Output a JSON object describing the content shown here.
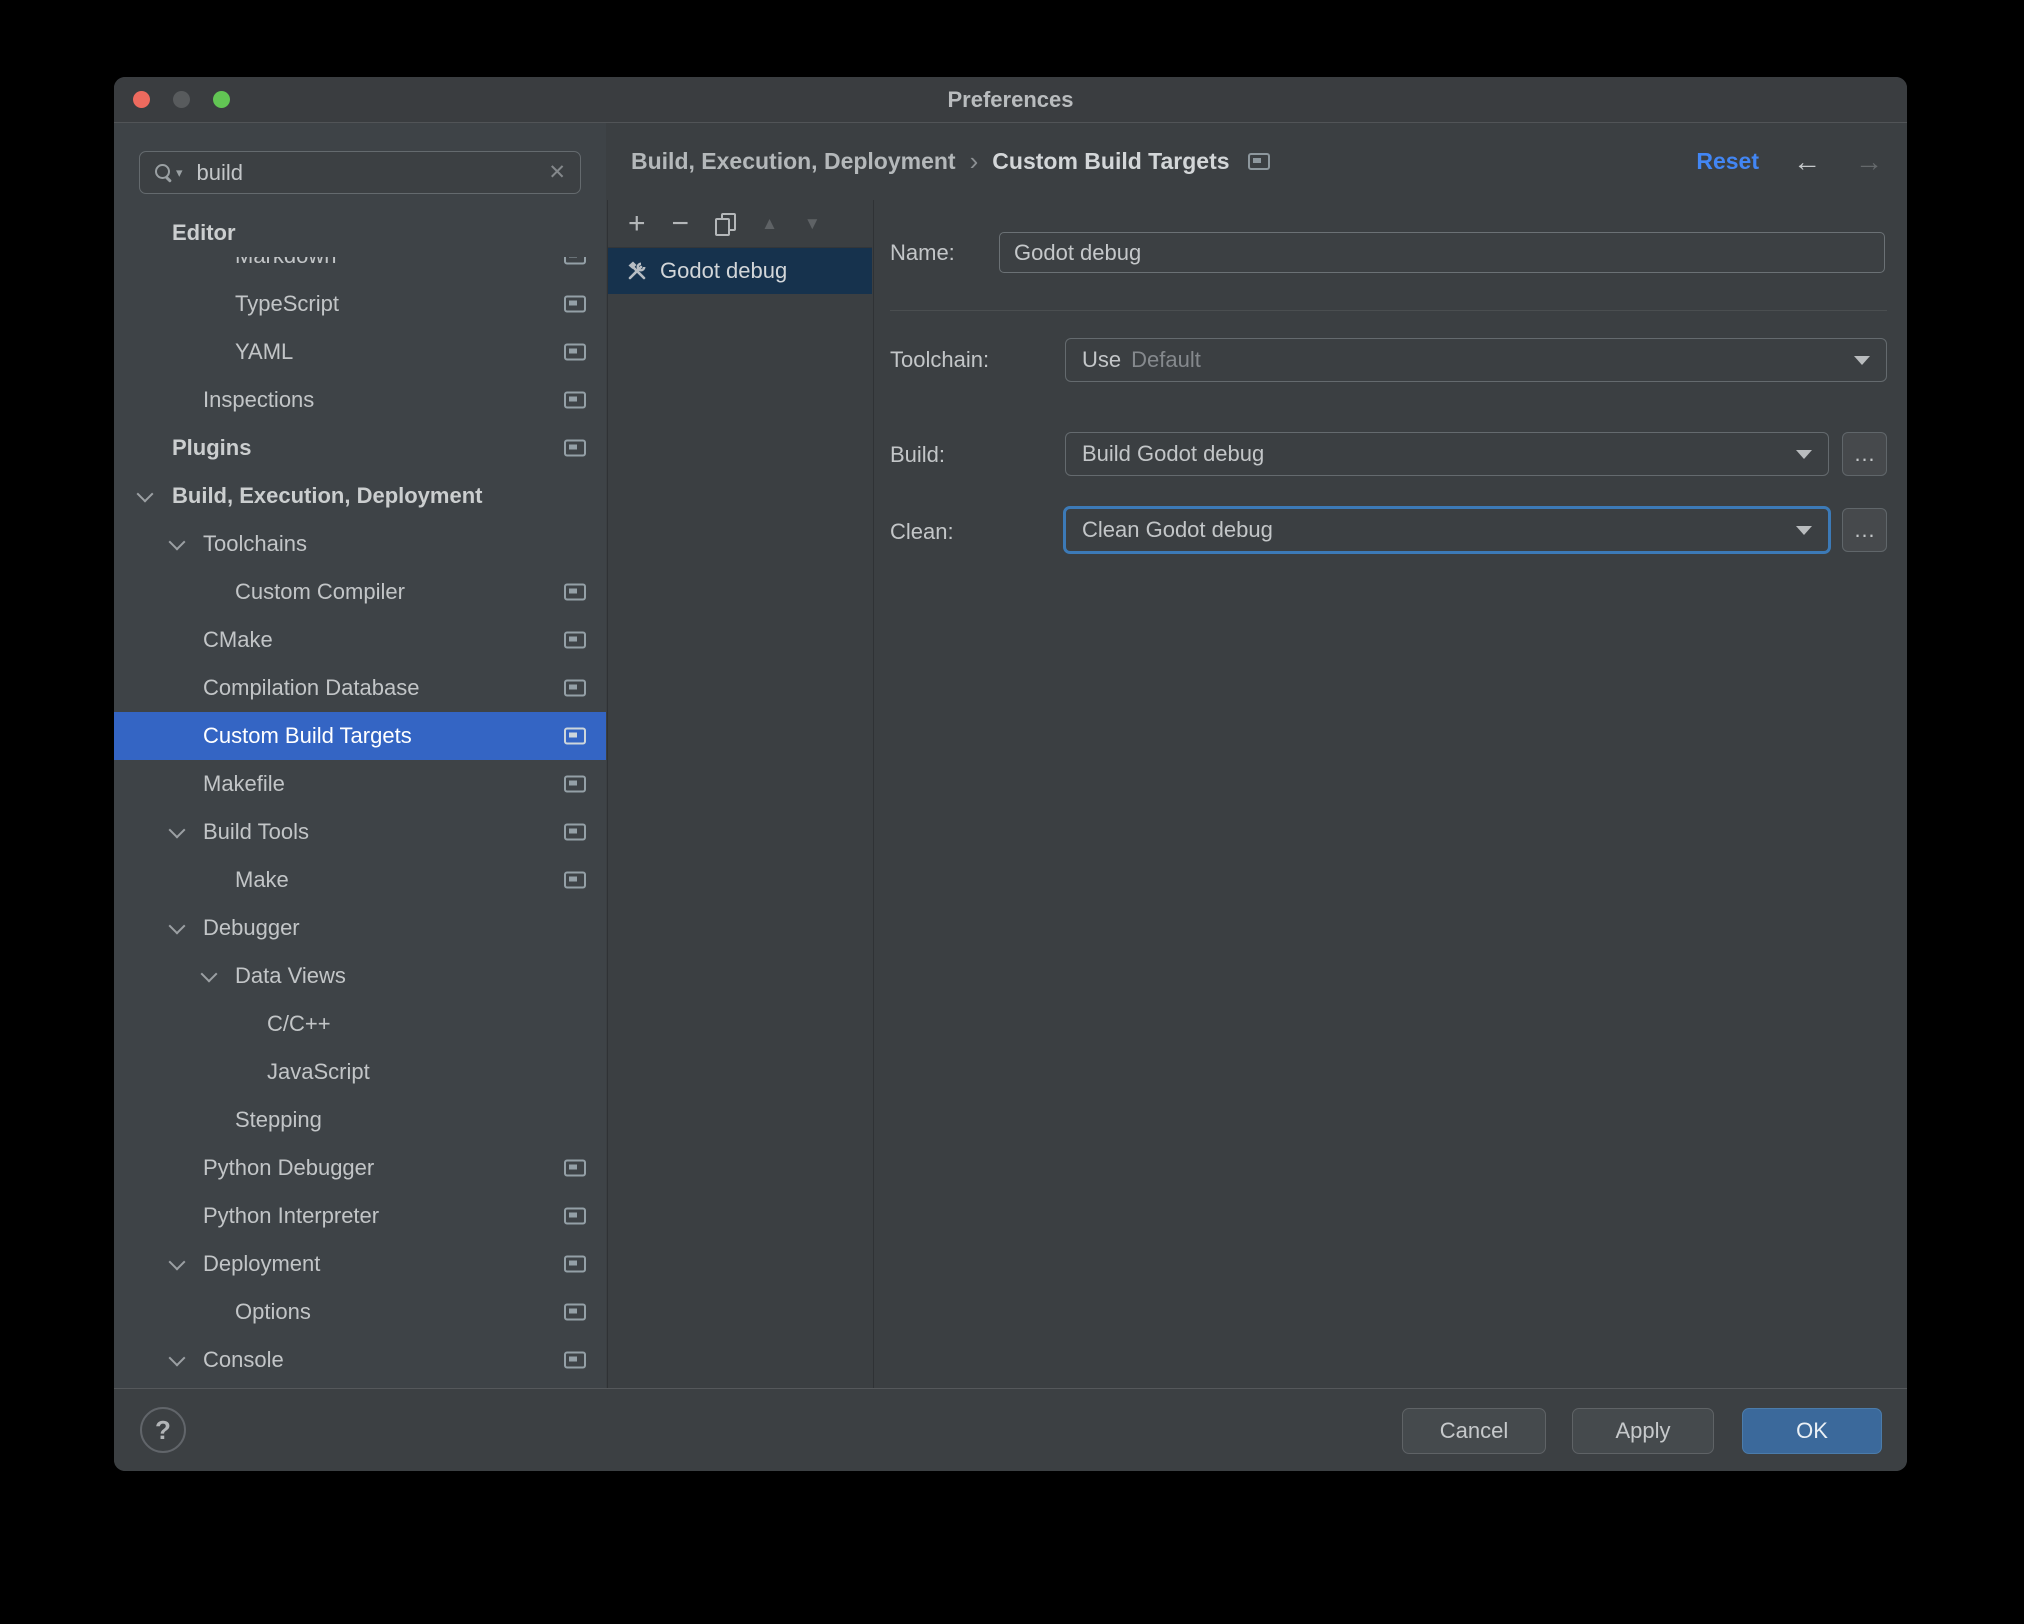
{
  "title": "Preferences",
  "search": {
    "value": "build"
  },
  "header": {
    "breadcrumb1": "Build, Execution, Deployment",
    "breadcrumb_sep": "›",
    "breadcrumb2": "Custom Build Targets",
    "reset_label": "Reset"
  },
  "icons": {
    "search": "magnifier-with-caret",
    "clear": "✕",
    "back": "←",
    "forward": "→",
    "add": "+",
    "remove": "−",
    "copy": "duplicate-pages",
    "move_up": "▲",
    "move_down": "▼",
    "target": "hammer-wrench",
    "help": "?",
    "browse": "…"
  },
  "sidebar": {
    "sticky_header": "Editor",
    "items": [
      {
        "label": "Markdown",
        "level": 3,
        "indicator": true
      },
      {
        "label": "TypeScript",
        "level": 3,
        "indicator": true
      },
      {
        "label": "YAML",
        "level": 3,
        "indicator": true
      },
      {
        "label": "Inspections",
        "level": 2,
        "indicator": true
      },
      {
        "label": "Plugins",
        "level": 1,
        "group": true,
        "indicator": true
      },
      {
        "label": "Build, Execution, Deployment",
        "level": 1,
        "group": true,
        "expanded": true
      },
      {
        "label": "Toolchains",
        "level": 2,
        "expanded": true
      },
      {
        "label": "Custom Compiler",
        "level": 3,
        "indicator": true
      },
      {
        "label": "CMake",
        "level": 2,
        "indicator": true
      },
      {
        "label": "Compilation Database",
        "level": 2,
        "indicator": true
      },
      {
        "label": "Custom Build Targets",
        "level": 2,
        "indicator": true,
        "selected": true
      },
      {
        "label": "Makefile",
        "level": 2,
        "indicator": true
      },
      {
        "label": "Build Tools",
        "level": 2,
        "expanded": true,
        "indicator": true
      },
      {
        "label": "Make",
        "level": 3,
        "indicator": true
      },
      {
        "label": "Debugger",
        "level": 2,
        "expanded": true
      },
      {
        "label": "Data Views",
        "level": 3,
        "expanded": true
      },
      {
        "label": "C/C++",
        "level": 4
      },
      {
        "label": "JavaScript",
        "level": 4
      },
      {
        "label": "Stepping",
        "level": 3
      },
      {
        "label": "Python Debugger",
        "level": 2,
        "indicator": true
      },
      {
        "label": "Python Interpreter",
        "level": 2,
        "indicator": true
      },
      {
        "label": "Deployment",
        "level": 2,
        "expanded": true,
        "indicator": true
      },
      {
        "label": "Options",
        "level": 3,
        "indicator": true
      },
      {
        "label": "Console",
        "level": 2,
        "expanded": true,
        "indicator": true
      }
    ]
  },
  "targets_list": {
    "items": [
      {
        "label": "Godot debug",
        "selected": true
      }
    ]
  },
  "form": {
    "name_label": "Name:",
    "name_value": "Godot debug",
    "toolchain_label": "Toolchain:",
    "toolchain_prefix": "Use",
    "toolchain_value": "Default",
    "build_label": "Build:",
    "build_value": "Build Godot debug",
    "clean_label": "Clean:",
    "clean_value": "Clean Godot debug"
  },
  "footer": {
    "help_label": "?",
    "cancel_label": "Cancel",
    "apply_label": "Apply",
    "ok_label": "OK"
  },
  "colors": {
    "selection_blue": "#3465c4",
    "list_selection": "#16324d",
    "link_blue": "#4286f4",
    "ok_blue": "#3b699b",
    "focus_ring": "#3c7ab7",
    "traffic_red": "#ed6a5e",
    "traffic_gray": "#585b5d",
    "traffic_green": "#62c554"
  }
}
